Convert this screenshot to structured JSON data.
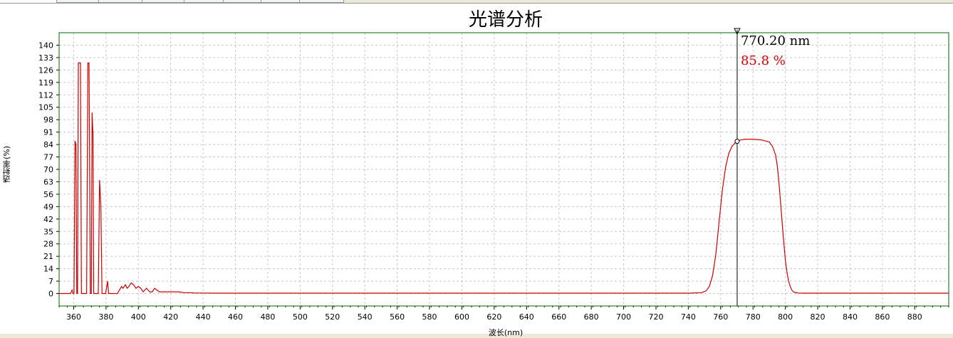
{
  "tabs": [
    "",
    "",
    "",
    "",
    "",
    "",
    "",
    ""
  ],
  "colors": {
    "series": "#cc0000",
    "grid": "#c8c8c8",
    "frame": "#006400",
    "cursor": "#000000",
    "readout_value": "#d40000"
  },
  "chart_data": {
    "type": "line",
    "title": "光谱分析",
    "xlabel": "波长(nm)",
    "ylabel": "透射率(%)",
    "xlim": [
      351,
      901
    ],
    "ylim": [
      -7,
      147
    ],
    "grid": true,
    "x_ticks": [
      360,
      380,
      400,
      420,
      440,
      460,
      480,
      500,
      520,
      540,
      560,
      580,
      600,
      620,
      640,
      660,
      680,
      700,
      720,
      740,
      760,
      780,
      800,
      820,
      840,
      860,
      880
    ],
    "y_ticks": [
      0,
      7,
      14,
      21,
      28,
      35,
      42,
      49,
      56,
      63,
      70,
      77,
      84,
      91,
      98,
      105,
      112,
      119,
      126,
      133,
      140
    ],
    "series": [
      {
        "x": [
          351,
          358,
          359,
          359.6,
          360.2,
          360.8,
          361.4,
          361.9,
          362.4,
          362.9,
          363.3,
          364.2,
          364.8,
          365.6,
          368,
          368.8,
          369.5,
          370.3,
          370.9,
          371.4,
          371.9,
          372.4,
          373,
          373.5,
          375.2,
          376,
          376.8,
          377.5,
          378.2,
          379,
          379.7,
          380.3,
          381,
          381.6,
          382.3,
          384,
          387,
          389.6,
          390.5,
          392,
          393,
          394.1,
          395.5,
          397,
          398.5,
          400,
          401.4,
          403,
          405,
          407,
          408.6,
          410,
          411.5,
          413,
          414.5,
          416,
          417.5,
          419,
          421,
          423,
          425,
          428,
          431,
          435,
          440,
          450,
          500,
          600,
          700,
          740,
          748,
          751,
          753,
          755,
          757,
          759,
          761,
          763,
          765,
          767,
          769,
          770.2,
          772,
          775,
          780,
          785,
          790,
          792,
          794,
          795,
          796,
          797,
          798,
          799,
          800,
          801,
          802,
          803,
          804,
          805,
          806,
          808,
          811,
          820,
          850,
          880,
          901
        ],
        "y": [
          0,
          0,
          2,
          0,
          0,
          86,
          84,
          0,
          0,
          130,
          130,
          130,
          0,
          0,
          0,
          130,
          130,
          0,
          0,
          102,
          90,
          0,
          0,
          0,
          0,
          64,
          50,
          0,
          0,
          0,
          0,
          3,
          7,
          0,
          0,
          0,
          0,
          4,
          3,
          5,
          3,
          4,
          6,
          5,
          3,
          4,
          3,
          1,
          3,
          1,
          1,
          3,
          2,
          1,
          1,
          1,
          1,
          1,
          1,
          1,
          1,
          0.5,
          0.5,
          0.3,
          0.3,
          0.2,
          0.2,
          0.2,
          0.2,
          0.2,
          0.5,
          1.5,
          4,
          10,
          22,
          40,
          58,
          71,
          79,
          83,
          85,
          85.8,
          86.5,
          87,
          87,
          86.6,
          85.5,
          83,
          78,
          72,
          63,
          52,
          40,
          29,
          19,
          12,
          7,
          4,
          2,
          1,
          0.6,
          0.3,
          0.2,
          0.2,
          0.2,
          0.2,
          0.2
        ]
      }
    ],
    "cursor": {
      "wavelength": 770.2,
      "value": 85.8,
      "wavelength_label": "770.20 nm",
      "value_label": "85.8 %"
    }
  }
}
